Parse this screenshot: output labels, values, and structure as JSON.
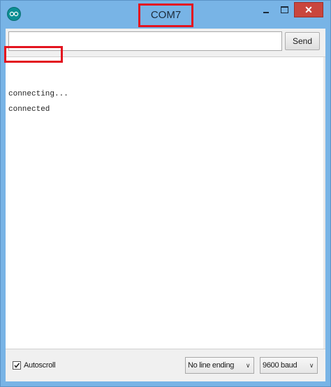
{
  "window": {
    "title": "COM7",
    "close_glyph": "✕"
  },
  "input": {
    "value": "",
    "placeholder": ""
  },
  "toolbar": {
    "send_label": "Send"
  },
  "output": {
    "lines": [
      "connecting...",
      "connected"
    ]
  },
  "footer": {
    "autoscroll_label": "Autoscroll",
    "autoscroll_checked": true,
    "line_ending": "No line ending",
    "baud_rate": "9600 baud"
  },
  "colors": {
    "highlight": "#e3141f",
    "titlebar": "#78b4e6",
    "close_button": "#c9463d"
  },
  "icons": {
    "app": "arduino-icon",
    "minimize": "minimize-icon",
    "maximize": "maximize-icon",
    "close": "close-icon",
    "chevron": "chevron-down-icon",
    "check": "check-icon"
  }
}
